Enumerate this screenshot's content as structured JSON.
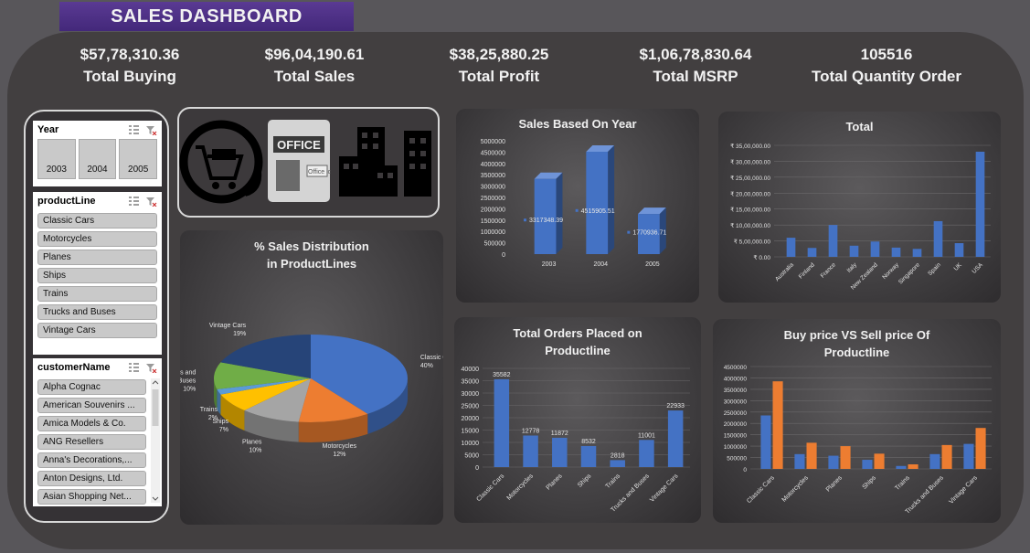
{
  "header": {
    "title": "SALES DASHBOARD"
  },
  "kpis": [
    {
      "value": "$57,78,310.36",
      "label": "Total Buying"
    },
    {
      "value": "$96,04,190.61",
      "label": "Total Sales"
    },
    {
      "value": "$38,25,880.25",
      "label": "Total Profit"
    },
    {
      "value": "$1,06,78,830.64",
      "label": "Total MSRP"
    },
    {
      "value": "105516",
      "label": "Total Quantity Order"
    }
  ],
  "slicers": {
    "year": {
      "title": "Year",
      "items": [
        "2003",
        "2004",
        "2005"
      ]
    },
    "product_line": {
      "title": "productLine",
      "items": [
        "Classic Cars",
        "Motorcycles",
        "Planes",
        "Ships",
        "Trains",
        "Trucks and Buses",
        "Vintage Cars"
      ]
    },
    "customer": {
      "title": "customerName",
      "items": [
        "Alpha Cognac",
        "American Souvenirs ...",
        "Amica Models & Co.",
        "ANG Resellers",
        "Anna's Decorations,...",
        "Anton Designs, Ltd.",
        "Asian Shopping Net..."
      ]
    }
  },
  "icons": {
    "office_sign": "OFFICE",
    "office_small": "Office ic"
  },
  "colors": {
    "blue": "#4472c4",
    "orange": "#ed7d31",
    "gray": "#a5a5a5",
    "yellow": "#ffc000",
    "light_blue": "#5b9bd5",
    "green": "#70ad47",
    "title_purple": "#4b2f86"
  },
  "chart_data": [
    {
      "type": "bar",
      "title": "Sales Based On Year",
      "categories": [
        "2003",
        "2004",
        "2005"
      ],
      "values": [
        3317348.39,
        4515905.51,
        1770936.71
      ],
      "data_labels": [
        "3317348.39",
        "4515905.51",
        "1770936.71"
      ],
      "yticks": [
        "5000000",
        "4500000",
        "4000000",
        "3500000",
        "3000000",
        "2500000",
        "2000000",
        "1500000",
        "1000000",
        "500000",
        "0"
      ],
      "ylim": [
        0,
        5000000
      ]
    },
    {
      "type": "bar",
      "title": "Total",
      "categories": [
        "Australia",
        "Finland",
        "France",
        "Italy",
        "New Zealand",
        "Norway",
        "Singapore",
        "Spain",
        "UK",
        "USA"
      ],
      "values": [
        600000,
        280000,
        1000000,
        350000,
        480000,
        290000,
        250000,
        1120000,
        430000,
        3300000
      ],
      "yticks": [
        "₹ 35,00,000.00",
        "₹ 30,00,000.00",
        "₹ 25,00,000.00",
        "₹ 20,00,000.00",
        "₹ 15,00,000.00",
        "₹ 10,00,000.00",
        "₹ 5,00,000.00",
        "₹ 0.00"
      ],
      "ylim": [
        0,
        3500000
      ]
    },
    {
      "type": "pie",
      "title": "% Sales Distribution in ProductLines",
      "title_lines": [
        "% Sales Distribution",
        "in ProductLines"
      ],
      "categories": [
        "Classic Cars",
        "Motorcycles",
        "Planes",
        "Ships",
        "Trains",
        "Trucks and Buses",
        "Vintage Cars"
      ],
      "values": [
        40,
        12,
        10,
        7,
        2,
        10,
        19
      ],
      "labels": [
        {
          "name": "Classic Cars",
          "pct": "40%"
        },
        {
          "name": "Motorcycles",
          "pct": "12%"
        },
        {
          "name": "Planes",
          "pct": "10%"
        },
        {
          "name": "Ships",
          "pct": "7%"
        },
        {
          "name": "Trains",
          "pct": "2%"
        },
        {
          "name": "Trucks and Buses",
          "name_lines": [
            "Trucks and",
            "Buses"
          ],
          "pct": "10%"
        },
        {
          "name": "Vintage Cars",
          "pct": "19%"
        }
      ]
    },
    {
      "type": "bar",
      "title": "Total Orders Placed on Productline",
      "title_lines": [
        "Total Orders Placed on",
        "Productline"
      ],
      "categories": [
        "Classic Cars",
        "Motorcycles",
        "Planes",
        "Ships",
        "Trains",
        "Trucks and Buses",
        "Vintage Cars"
      ],
      "values": [
        35582,
        12778,
        11872,
        8532,
        2818,
        11001,
        22933
      ],
      "yticks": [
        "40000",
        "35000",
        "30000",
        "25000",
        "20000",
        "15000",
        "10000",
        "5000",
        "0"
      ],
      "ylim": [
        0,
        40000
      ]
    },
    {
      "type": "bar",
      "title": "Buy price VS Sell price Of Productline",
      "title_lines": [
        "Buy price VS Sell price Of",
        "Productline"
      ],
      "categories": [
        "Classic Cars",
        "Motorcycles",
        "Planes",
        "Ships",
        "Trains",
        "Trucks and Buses",
        "Vintage Cars"
      ],
      "series": [
        {
          "values": [
            2350000,
            650000,
            580000,
            400000,
            130000,
            650000,
            1100000
          ]
        },
        {
          "values": [
            3850000,
            1150000,
            1000000,
            670000,
            200000,
            1050000,
            1800000
          ]
        }
      ],
      "yticks": [
        "4500000",
        "4000000",
        "3500000",
        "3000000",
        "2500000",
        "2000000",
        "1500000",
        "1000000",
        "500000",
        "0"
      ],
      "ylim": [
        0,
        4500000
      ]
    }
  ]
}
